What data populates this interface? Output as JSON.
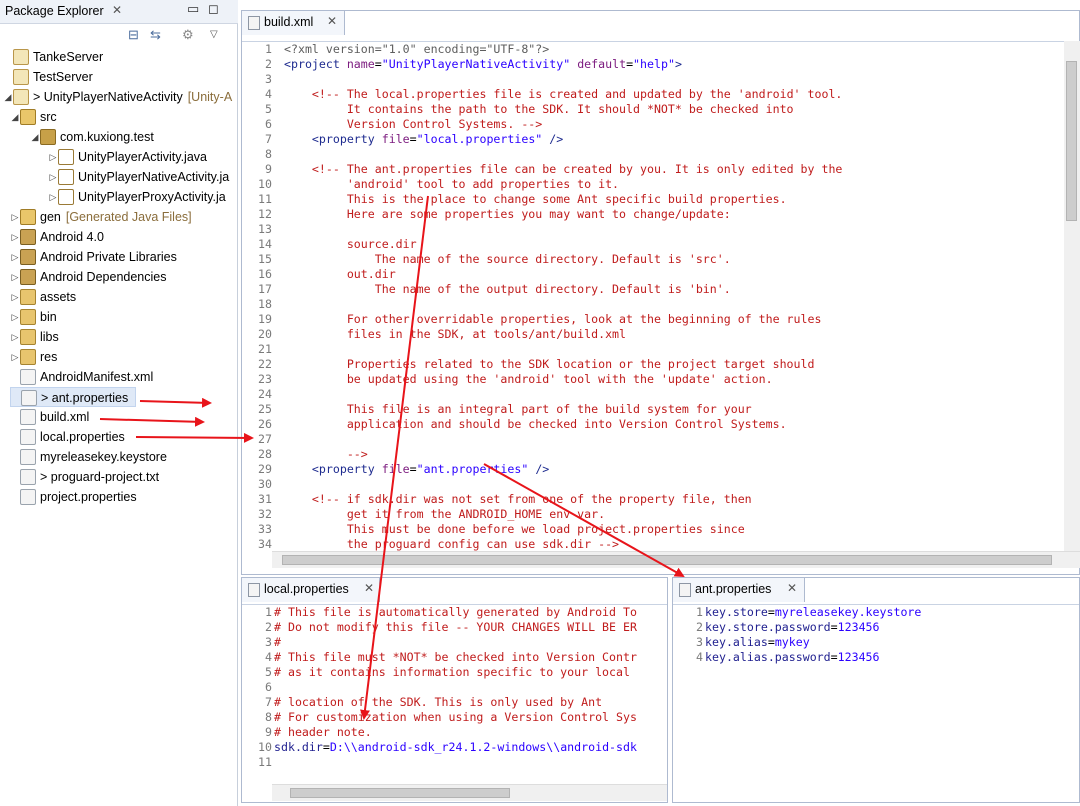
{
  "package_explorer": {
    "title": "Package Explorer",
    "close_glyph": "✕",
    "tree": [
      {
        "label": "TankeServer",
        "icon": "project-icon"
      },
      {
        "label": "TestServer",
        "icon": "project-icon"
      },
      {
        "label": "> UnityPlayerNativeActivity",
        "suffix": "[Unity-A",
        "icon": "project-icon"
      },
      {
        "label": "src",
        "icon": "source-folder-icon"
      },
      {
        "label": "com.kuxiong.test",
        "icon": "package-icon"
      },
      {
        "label": "UnityPlayerActivity.java",
        "icon": "java-file-icon"
      },
      {
        "label": "UnityPlayerNativeActivity.ja",
        "icon": "java-file-icon"
      },
      {
        "label": "UnityPlayerProxyActivity.ja",
        "icon": "java-file-icon"
      },
      {
        "label": "gen",
        "suffix": "[Generated Java Files]",
        "icon": "source-folder-icon"
      },
      {
        "label": "Android 4.0",
        "icon": "library-icon"
      },
      {
        "label": "Android Private Libraries",
        "icon": "library-icon"
      },
      {
        "label": "Android Dependencies",
        "icon": "library-icon"
      },
      {
        "label": "assets",
        "icon": "folder-icon"
      },
      {
        "label": "bin",
        "icon": "folder-icon"
      },
      {
        "label": "libs",
        "icon": "folder-icon"
      },
      {
        "label": "res",
        "icon": "folder-icon"
      },
      {
        "label": "AndroidManifest.xml",
        "icon": "xml-file-icon"
      },
      {
        "label": "> ant.properties",
        "icon": "properties-file-icon"
      },
      {
        "label": "build.xml",
        "icon": "xml-file-icon"
      },
      {
        "label": "local.properties",
        "icon": "properties-file-icon"
      },
      {
        "label": "myreleasekey.keystore",
        "icon": "file-icon"
      },
      {
        "label": "> proguard-project.txt",
        "icon": "text-file-icon"
      },
      {
        "label": "project.properties",
        "icon": "properties-file-icon"
      }
    ]
  },
  "build_editor": {
    "tab": "build.xml",
    "lines": [
      {
        "n": "1",
        "t": "<?xml version=\"1.0\" encoding=\"UTF-8\"?>"
      },
      {
        "n": "2",
        "t": "<project name=\"UnityPlayerNativeActivity\" default=\"help\">"
      },
      {
        "n": "3",
        "t": ""
      },
      {
        "n": "4",
        "t": "    <!-- The local.properties file is created and updated by the 'android' tool."
      },
      {
        "n": "5",
        "t": "         It contains the path to the SDK. It should *NOT* be checked into"
      },
      {
        "n": "6",
        "t": "         Version Control Systems. -->"
      },
      {
        "n": "7",
        "t": "    <property file=\"local.properties\" />"
      },
      {
        "n": "8",
        "t": ""
      },
      {
        "n": "9",
        "t": "    <!-- The ant.properties file can be created by you. It is only edited by the"
      },
      {
        "n": "10",
        "t": "         'android' tool to add properties to it."
      },
      {
        "n": "11",
        "t": "         This is the place to change some Ant specific build properties."
      },
      {
        "n": "12",
        "t": "         Here are some properties you may want to change/update:"
      },
      {
        "n": "13",
        "t": ""
      },
      {
        "n": "14",
        "t": "         source.dir"
      },
      {
        "n": "15",
        "t": "             The name of the source directory. Default is 'src'."
      },
      {
        "n": "16",
        "t": "         out.dir"
      },
      {
        "n": "17",
        "t": "             The name of the output directory. Default is 'bin'."
      },
      {
        "n": "18",
        "t": ""
      },
      {
        "n": "19",
        "t": "         For other overridable properties, look at the beginning of the rules"
      },
      {
        "n": "20",
        "t": "         files in the SDK, at tools/ant/build.xml"
      },
      {
        "n": "21",
        "t": ""
      },
      {
        "n": "22",
        "t": "         Properties related to the SDK location or the project target should"
      },
      {
        "n": "23",
        "t": "         be updated using the 'android' tool with the 'update' action."
      },
      {
        "n": "24",
        "t": ""
      },
      {
        "n": "25",
        "t": "         This file is an integral part of the build system for your"
      },
      {
        "n": "26",
        "t": "         application and should be checked into Version Control Systems."
      },
      {
        "n": "27",
        "t": ""
      },
      {
        "n": "28",
        "t": "         -->"
      },
      {
        "n": "29",
        "t": "    <property file=\"ant.properties\" />"
      },
      {
        "n": "30",
        "t": ""
      },
      {
        "n": "31",
        "t": "    <!-- if sdk.dir was not set from one of the property file, then"
      },
      {
        "n": "32",
        "t": "         get it from the ANDROID_HOME env var."
      },
      {
        "n": "33",
        "t": "         This must be done before we load project.properties since"
      },
      {
        "n": "34",
        "t": "         the proguard config can use sdk.dir -->"
      }
    ]
  },
  "local_editor": {
    "tab": "local.properties",
    "lines": [
      {
        "n": "1",
        "t": "# This file is automatically generated by Android To"
      },
      {
        "n": "2",
        "t": "# Do not modify this file -- YOUR CHANGES WILL BE ER"
      },
      {
        "n": "3",
        "t": "#"
      },
      {
        "n": "4",
        "t": "# This file must *NOT* be checked into Version Contr"
      },
      {
        "n": "5",
        "t": "# as it contains information specific to your local"
      },
      {
        "n": "6",
        "t": ""
      },
      {
        "n": "7",
        "t": "# location of the SDK. This is only used by Ant"
      },
      {
        "n": "8",
        "t": "# For customization when using a Version Control Sys"
      },
      {
        "n": "9",
        "t": "# header note."
      },
      {
        "n": "10",
        "t": "sdk.dir=D:\\\\android-sdk_r24.1.2-windows\\\\android-sdk"
      },
      {
        "n": "11",
        "t": ""
      }
    ]
  },
  "ant_editor": {
    "tab": "ant.properties",
    "lines": [
      {
        "n": "1",
        "key": "key.store",
        "val": "myreleasekey.keystore"
      },
      {
        "n": "2",
        "key": "key.store.password",
        "val": "123456"
      },
      {
        "n": "3",
        "key": "key.alias",
        "val": "mykey"
      },
      {
        "n": "4",
        "key": "key.alias.password",
        "val": "123456"
      }
    ]
  },
  "colors": {
    "annotation_arrow": "#e8141a",
    "comment": "#c01c1c",
    "tag": "#1e2b8f",
    "string": "#2a00ff"
  }
}
